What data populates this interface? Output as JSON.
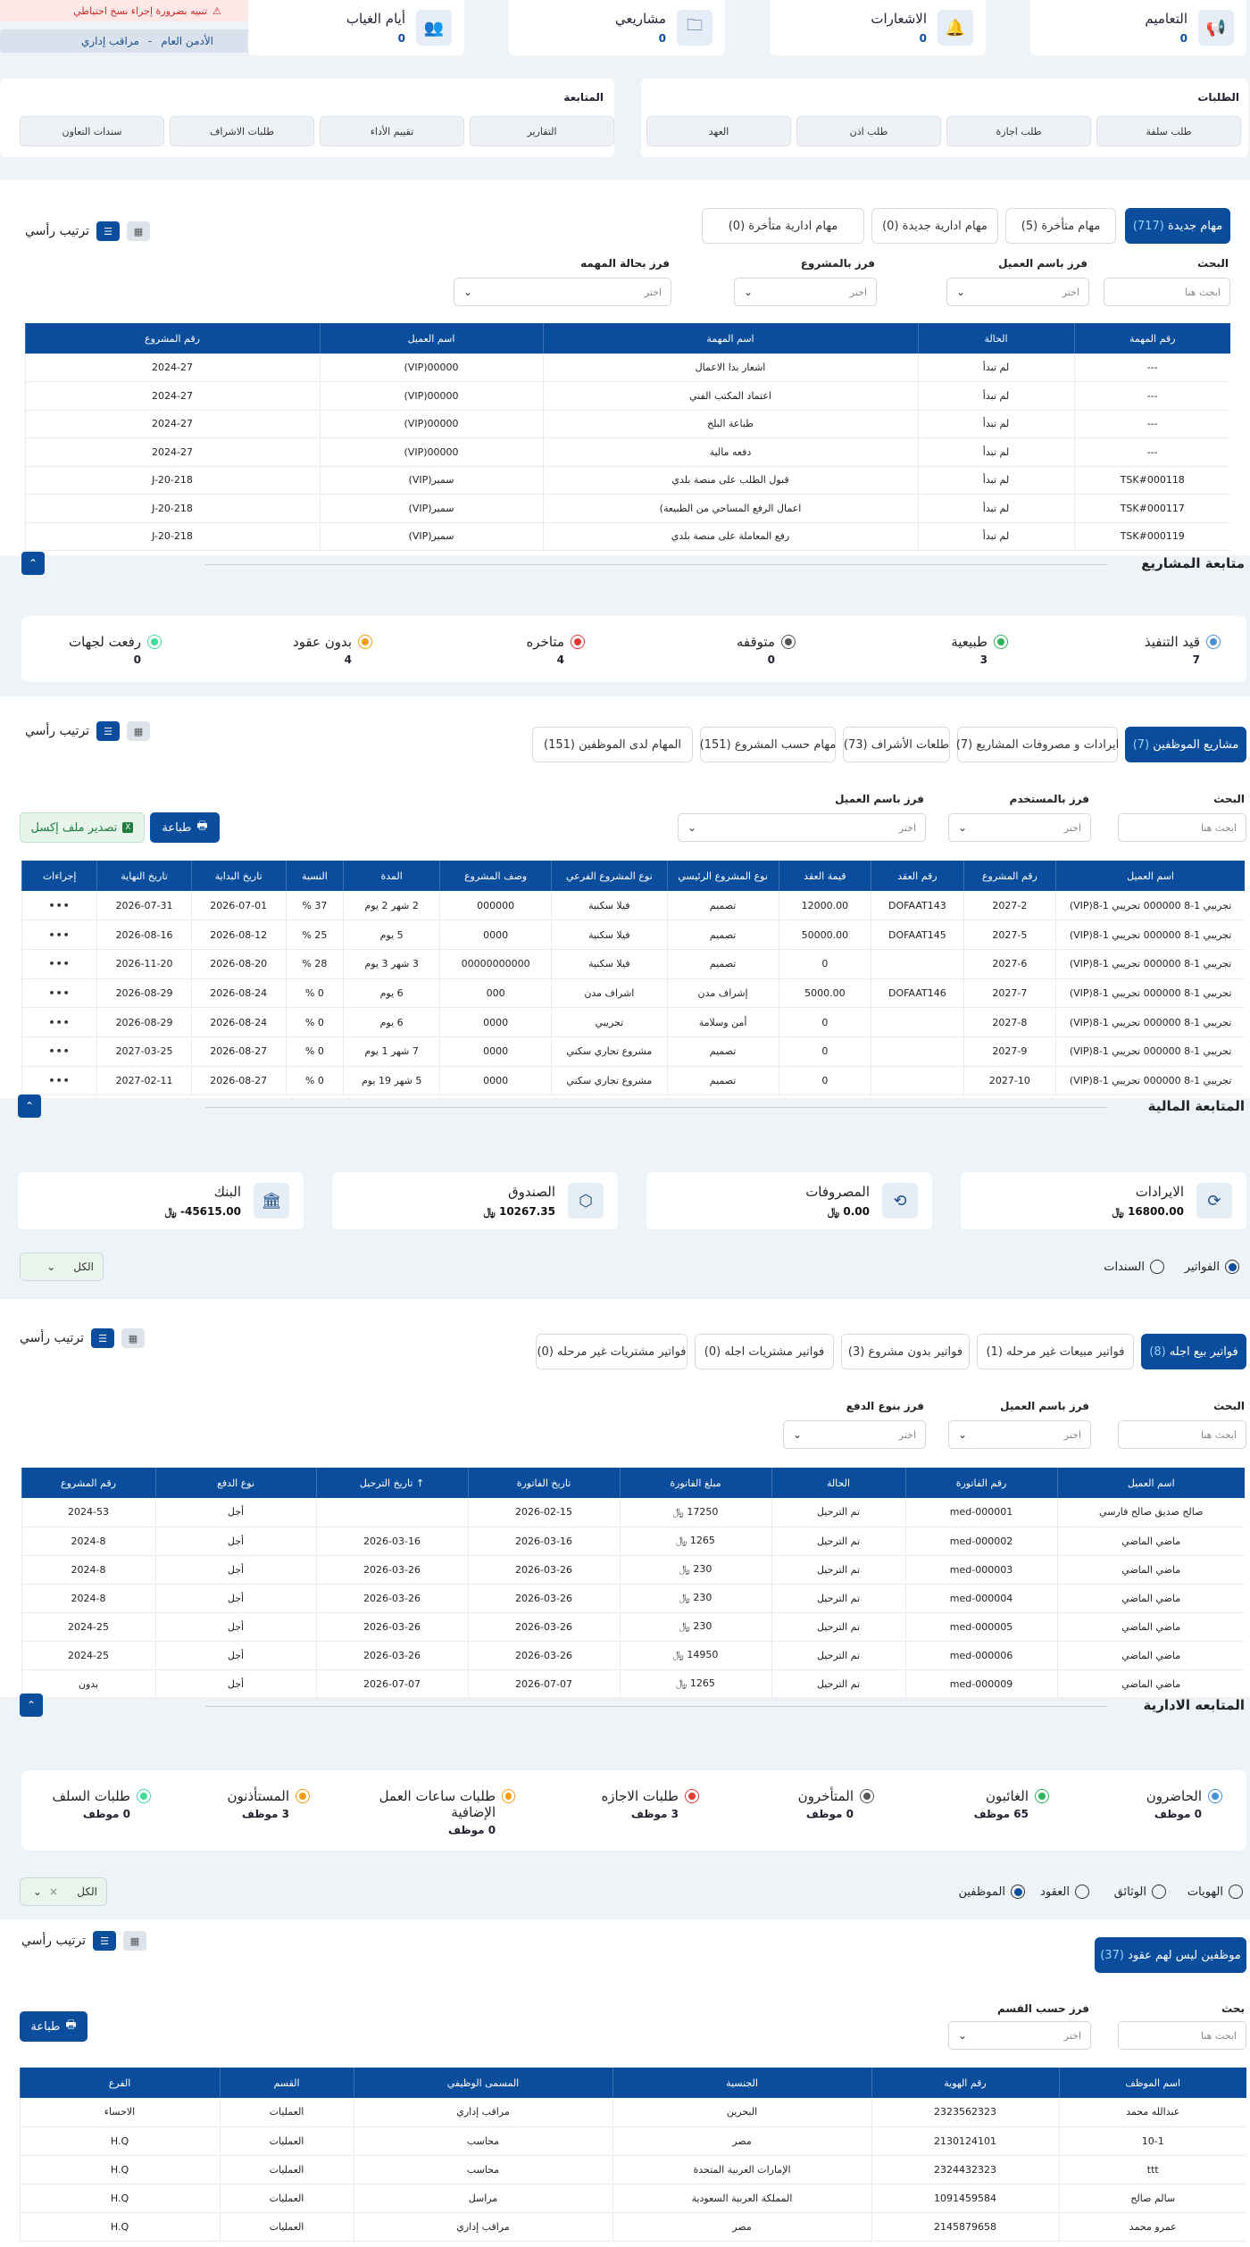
{
  "topbar": {
    "backup_warning": "تنبيه بضرورة إجراء نسخ احتياطي",
    "user_name": "الأدمن العام",
    "user_sep": "-",
    "user_role": "مراقب إداري"
  },
  "stats": [
    {
      "title": "التعاميم",
      "value": "0",
      "icon": "megaphone-icon"
    },
    {
      "title": "الاشعارات",
      "value": "0",
      "icon": "bell-icon"
    },
    {
      "title": "مشاريعي",
      "value": "0",
      "icon": "folder-icon"
    },
    {
      "title": "أيام الغياب",
      "value": "0",
      "icon": "users-icon"
    }
  ],
  "requests": {
    "title": "الطلبات",
    "buttons": [
      "طلب سلفة",
      "طلب اجازة",
      "طلب اذن",
      "العهد"
    ]
  },
  "followup": {
    "title": "المتابعة",
    "buttons": [
      "التقارير",
      "تقييم الأداء",
      "طلبات الاشراف",
      "سندات التعاون"
    ]
  },
  "tasks": {
    "sort_label": "ترتيب رأسي",
    "tabs": [
      {
        "label": "مهام جديدة",
        "count": "(717)"
      },
      {
        "label": "مهام متأخرة",
        "count": "(5)"
      },
      {
        "label": "مهام ادارية جديدة",
        "count": "(0)"
      },
      {
        "label": "مهام ادارية متأخرة",
        "count": "(0)"
      }
    ],
    "filters": [
      {
        "label": "البحث",
        "placeholder": "ابحث هنا"
      },
      {
        "label": "فرز باسم العميل",
        "placeholder": "اختر"
      },
      {
        "label": "فرز بالمشروع",
        "placeholder": "اختر"
      },
      {
        "label": "فرز بحالة المهمه",
        "placeholder": "اختر"
      }
    ],
    "columns": [
      "رقم المهمة",
      "الحالة",
      "اسم المهمة",
      "اسم العميل",
      "رقم المشروع"
    ],
    "rows": [
      [
        "---",
        "لم تبدأ",
        "اشعار بدا الاعمال",
        "00000(VIP)",
        "2024-27"
      ],
      [
        "---",
        "لم تبدأ",
        "اعتماد المكتب الفني",
        "00000(VIP)",
        "2024-27"
      ],
      [
        "---",
        "لم تبدأ",
        "طباعة البلخ",
        "00000(VIP)",
        "2024-27"
      ],
      [
        "---",
        "لم تبدأ",
        "دفعه مالية",
        "00000(VIP)",
        "2024-27"
      ],
      [
        "TSK#000118",
        "لم تبدأ",
        "قبول الطلب على منصة بلدي",
        "سمير(VIP)",
        "J-20-218"
      ],
      [
        "TSK#000117",
        "لم تبدأ",
        "اعمال الرفع المساحي من الطبيعة)",
        "سمير(VIP)",
        "J-20-218"
      ],
      [
        "TSK#000119",
        "لم تبدأ",
        "رفع المعاملة على منصة بلدي",
        "سمير(VIP)",
        "J-20-218"
      ]
    ]
  },
  "projects": {
    "title": "متابعة المشاريع",
    "statuses": [
      {
        "label": "قيد التنفيذ",
        "value": "7",
        "color": "#4a90d9"
      },
      {
        "label": "طبيعية",
        "value": "3",
        "color": "#2db45a"
      },
      {
        "label": "متوقفه",
        "value": "0",
        "color": "#555555"
      },
      {
        "label": "متاخره",
        "value": "4",
        "color": "#e53935"
      },
      {
        "label": "بدون عقود",
        "value": "4",
        "color": "#f59c0b"
      },
      {
        "label": "رفعت لجهات",
        "value": "0",
        "color": "#3ddc97"
      }
    ],
    "sort_label": "ترتيب رأسي",
    "tabs": [
      {
        "label": "مشاريع الموظفين",
        "count": "(7)"
      },
      {
        "label": "ايرادات و مصروفات المشاريع",
        "count": "(7)"
      },
      {
        "label": "طلعات الأشراف",
        "count": "(73)"
      },
      {
        "label": "مهام حسب المشروع",
        "count": "(151)"
      },
      {
        "label": "المهام لدى الموظفين",
        "count": "(151)"
      }
    ],
    "filters": [
      {
        "label": "البحث",
        "placeholder": "ابحث هنا"
      },
      {
        "label": "فرز بالمستخدم",
        "placeholder": "اختر"
      },
      {
        "label": "فرز باسم العميل",
        "placeholder": "اختر"
      }
    ],
    "print_label": "طباعة",
    "export_label": "تصدير ملف إكسل",
    "columns": [
      "اسم العميل",
      "رقم المشروع",
      "رقم العقد",
      "قيمة العقد",
      "نوع المشروع الرئيسي",
      "نوع المشروع الفرعي",
      "وصف المشروع",
      "المدة",
      "النسبة",
      "تاريخ البداية",
      "تاريخ النهاية",
      "إجراءات"
    ],
    "rows": [
      [
        "تجريبي 1-8 000000 تجريبي 1-8(VIP)",
        "2027-2",
        "DOFAAT143",
        "12000.00",
        "تصميم",
        "فيلا سكنية",
        "000000",
        "2 شهر 2 يوم",
        "37 %",
        "2026-07-01",
        "2026-07-31",
        "•••"
      ],
      [
        "تجريبي 1-8 000000 تجريبي 1-8(VIP)",
        "2027-5",
        "DOFAAT145",
        "50000.00",
        "تصميم",
        "فيلا سكنية",
        "0000",
        "5 يوم",
        "25 %",
        "2026-08-12",
        "2026-08-16",
        "•••"
      ],
      [
        "تجريبي 1-8 000000 تجريبي 1-8(VIP)",
        "2027-6",
        "",
        "0",
        "تصميم",
        "فيلا سكنية",
        "00000000000",
        "3 شهر 3 يوم",
        "28 %",
        "2026-08-20",
        "2026-11-20",
        "•••"
      ],
      [
        "تجريبي 1-8 000000 تجريبي 1-8(VIP)",
        "2027-7",
        "DOFAAT146",
        "5000.00",
        "إشراف مدن",
        "اشراف مدن",
        "000",
        "6 يوم",
        "0 %",
        "2026-08-24",
        "2026-08-29",
        "•••"
      ],
      [
        "تجريبي 1-8 000000 تجريبي 1-8(VIP)",
        "2027-8",
        "",
        "0",
        "أمن وسلامة",
        "تجريبي",
        "0000",
        "6 يوم",
        "0 %",
        "2026-08-24",
        "2026-08-29",
        "•••"
      ],
      [
        "تجريبي 1-8 000000 تجريبي 1-8(VIP)",
        "2027-9",
        "",
        "0",
        "تصميم",
        "مشروع تجاري سكني",
        "0000",
        "7 شهر 1 يوم",
        "0 %",
        "2026-08-27",
        "2027-03-25",
        "•••"
      ],
      [
        "تجريبي 1-8 000000 تجريبي 1-8(VIP)",
        "2027-10",
        "",
        "0",
        "تصميم",
        "مشروع تجاري سكني",
        "0000",
        "5 شهر 19 يوم",
        "0 %",
        "2026-08-27",
        "2027-02-11",
        "•••"
      ]
    ]
  },
  "finance": {
    "title": "المتابعة المالية",
    "cards": [
      {
        "title": "الايرادات",
        "value": "16800.00 ﷼",
        "icon": "revenue-icon"
      },
      {
        "title": "المصروفات",
        "value": "0.00 ﷼",
        "icon": "expense-icon"
      },
      {
        "title": "الصندوق",
        "value": "10267.35 ﷼",
        "icon": "box-icon"
      },
      {
        "title": "البنك",
        "value": "45615.00- ﷼",
        "icon": "bank-icon"
      }
    ],
    "radios": [
      {
        "label": "الفواتير",
        "checked": true
      },
      {
        "label": "السندات",
        "checked": false
      }
    ],
    "select_value": "الكل",
    "sort_label": "ترتيب رأسي",
    "tabs": [
      {
        "label": "فواتير بيع اجله",
        "count": "(8)"
      },
      {
        "label": "فواتير مبيعات غير مرحله",
        "count": "(1)"
      },
      {
        "label": "فواتير بدون مشروع",
        "count": "(3)"
      },
      {
        "label": "فواتير مشتريات اجله",
        "count": "(0)"
      },
      {
        "label": "فواتير مشتريات غير مرحله",
        "count": "(0)"
      }
    ],
    "filters": [
      {
        "label": "البحث",
        "placeholder": "ابحث هنا"
      },
      {
        "label": "فرز باسم العميل",
        "placeholder": "اختر"
      },
      {
        "label": "فرز بنوع الدفع",
        "placeholder": "اختر"
      }
    ],
    "columns": [
      "اسم العميل",
      "رقم الفاتورة",
      "الحالة",
      "مبلغ الفاتورة",
      "تاريخ الفاتورة",
      "↑ تاريخ الترحيل",
      "نوع الدفع",
      "رقم المشروع"
    ],
    "rows": [
      [
        "صالح صديق صالح فارسي",
        "med-000001",
        "تم الترحيل",
        "17250 ﷼",
        "2026-02-15",
        "",
        "أجل",
        "2024-53"
      ],
      [
        "ماضي الماضي",
        "med-000002",
        "تم الترحيل",
        "1265 ﷼",
        "2026-03-16",
        "2026-03-16",
        "أجل",
        "2024-8"
      ],
      [
        "ماضي الماضي",
        "med-000003",
        "تم الترحيل",
        "230 ﷼",
        "2026-03-26",
        "2026-03-26",
        "أجل",
        "2024-8"
      ],
      [
        "ماضي الماضي",
        "med-000004",
        "تم الترحيل",
        "230 ﷼",
        "2026-03-26",
        "2026-03-26",
        "أجل",
        "2024-8"
      ],
      [
        "ماضي الماضي",
        "med-000005",
        "تم الترحيل",
        "230 ﷼",
        "2026-03-26",
        "2026-03-26",
        "أجل",
        "2024-25"
      ],
      [
        "ماضي الماضي",
        "med-000006",
        "تم الترحيل",
        "14950 ﷼",
        "2026-03-26",
        "2026-03-26",
        "أجل",
        "2024-25"
      ],
      [
        "ماضي الماضي",
        "med-000009",
        "تم الترحيل",
        "1265 ﷼",
        "2026-07-07",
        "2026-07-07",
        "أجل",
        "بدون"
      ]
    ]
  },
  "admin": {
    "title": "المتابعه الادارية",
    "statuses": [
      {
        "label": "الحاضرون",
        "value": "0 موظف",
        "color": "#4a90d9"
      },
      {
        "label": "الغائبون",
        "value": "65 موظف",
        "color": "#2db45a"
      },
      {
        "label": "المتأخرون",
        "value": "0 موظف",
        "color": "#555555"
      },
      {
        "label": "طلبات الاجازه",
        "value": "3 موظف",
        "color": "#e53935"
      },
      {
        "label": "طلبات ساعات العمل الإضافية",
        "value": "0 موظف",
        "color": "#f59c0b"
      },
      {
        "label": "المستأذنون",
        "value": "3 موظف",
        "color": "#f59c0b"
      },
      {
        "label": "طلبات السلف",
        "value": "0 موظف",
        "color": "#3ddc97"
      }
    ],
    "radios": [
      {
        "label": "الهويات",
        "checked": false
      },
      {
        "label": "الوثائق",
        "checked": false
      },
      {
        "label": "العقود",
        "checked": false
      },
      {
        "label": "الموظفين",
        "checked": true
      }
    ],
    "select_value": "الكل",
    "select_clear": "×",
    "sort_label": "ترتيب رأسي",
    "tab": {
      "label": "موظفين ليس لهم عقود",
      "count": "(37)"
    },
    "filters": [
      {
        "label": "بحث",
        "placeholder": "ابحث هنا"
      },
      {
        "label": "فرز حسب القسم",
        "placeholder": "اختر"
      }
    ],
    "print_label": "طباعة",
    "columns": [
      "اسم الموظف",
      "رقم الهوية",
      "الجنسية",
      "المسمى الوظيفي",
      "القسم",
      "الفرع"
    ],
    "rows": [
      [
        "عبدالله محمد",
        "2323562323",
        "البحرين",
        "مراقب إداري",
        "العمليات",
        "الاحساء"
      ],
      [
        "10-1",
        "2130124101",
        "مصر",
        "محاسب",
        "العمليات",
        "H.Q"
      ],
      [
        "ttt",
        "2324432323",
        "الإمارات العربية المتحدة",
        "محاسب",
        "العمليات",
        "H.Q"
      ],
      [
        "سالم صالح",
        "1091459584",
        "المملكة العربية السعودية",
        "مراسل",
        "العمليات",
        "H.Q"
      ],
      [
        "عمرو محمد",
        "2145879658",
        "مصر",
        "مراقب إداري",
        "العمليات",
        "H.Q"
      ]
    ]
  }
}
